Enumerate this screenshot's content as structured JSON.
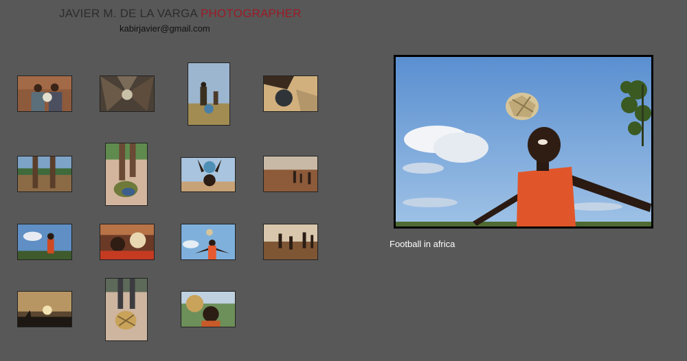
{
  "header": {
    "name": "JAVIER M. DE LA VARGA",
    "profession": "PHOTOGRAPHER",
    "email": "kabirjavier@gmail.com"
  },
  "viewer": {
    "caption": "Football in africa"
  },
  "colors": {
    "background": "#585858",
    "title_accent": "#9b1b26",
    "caption_text": "#ffffff"
  }
}
